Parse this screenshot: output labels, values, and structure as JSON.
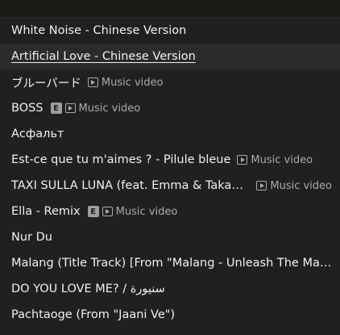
{
  "songs": [
    {
      "title": "White Noise - Chinese Version",
      "explicit": false,
      "video": false,
      "hovered": false
    },
    {
      "title": "Artificial Love - Chinese Version",
      "explicit": false,
      "video": false,
      "hovered": true
    },
    {
      "title": "ブルーバード",
      "explicit": false,
      "video": true,
      "hovered": false
    },
    {
      "title": "BOSS",
      "explicit": true,
      "video": true,
      "hovered": false
    },
    {
      "title": "Асфальт",
      "explicit": false,
      "video": false,
      "hovered": false
    },
    {
      "title": "Est-ce que tu m'aimes ? - Pilule bleue",
      "explicit": false,
      "video": true,
      "hovered": false
    },
    {
      "title": "TAXI SULLA LUNA (feat. Emma & Takagi & Ketra)",
      "explicit": false,
      "video": true,
      "hovered": false
    },
    {
      "title": "Ella - Remix",
      "explicit": true,
      "video": true,
      "hovered": false
    },
    {
      "title": "Nur Du",
      "explicit": false,
      "video": false,
      "hovered": false
    },
    {
      "title": "Malang (Title Track) [From \"Malang - Unleash The Madness\"]",
      "explicit": false,
      "video": false,
      "hovered": false
    },
    {
      "title": "DO YOU LOVE ME? / سنيورة",
      "explicit": false,
      "video": false,
      "hovered": false
    },
    {
      "title": "Pachtaoge (From \"Jaani Ve\")",
      "explicit": false,
      "video": false,
      "hovered": false
    }
  ],
  "labels": {
    "music_video": "Music video",
    "explicit": "E"
  },
  "icons": {
    "music_video": "play-box-icon",
    "explicit": "explicit-badge-icon"
  },
  "colors": {
    "background": "#202020",
    "hover_background": "#2b2b2b",
    "title_text": "#f1f1f1",
    "secondary_text": "#aaaaaa"
  }
}
